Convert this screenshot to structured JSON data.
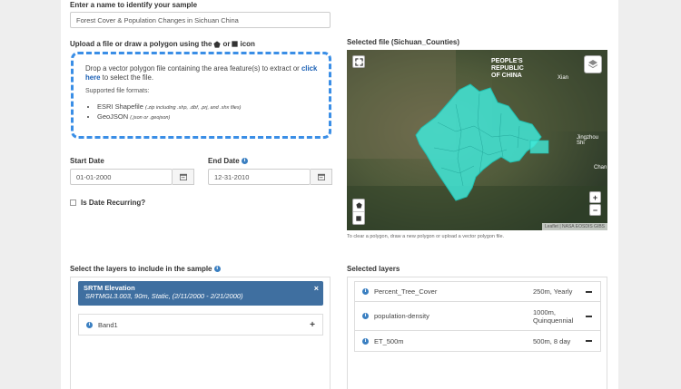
{
  "sample_name": {
    "label": "Enter a name to identify your sample",
    "value": "Forest Cover & Population Changes in Sichuan China"
  },
  "upload": {
    "label_prefix": "Upload a file or draw a polygon using the",
    "label_or": "or",
    "label_suffix": "icon",
    "drop_text": "Drop a vector polygon file containing the area feature(s) to extract or",
    "click_link": "click here",
    "drop_text_end": "to select the file.",
    "formats_label": "Supported file formats:",
    "formats": [
      {
        "name": "ESRI Shapefile",
        "detail": "(.zip including .shp, .dbf, .prj, and .shx files)"
      },
      {
        "name": "GeoJSON",
        "detail": "(.json or .geojson)"
      }
    ]
  },
  "dates": {
    "start_label": "Start Date",
    "start_value": "01-01-2000",
    "end_label": "End Date",
    "end_value": "12-31-2010",
    "recurring_label": "Is Date Recurring?"
  },
  "map": {
    "title": "Selected file (Sichuan_Counties)",
    "country_label_1": "PEOPLE'S",
    "country_label_2": "REPUBLIC",
    "country_label_3": "OF CHINA",
    "place_1": "Xian",
    "place_2": "Jingzhou Shi",
    "place_3": "Chan",
    "attribution": "Leaflet | NASA EOSDIS GIBS",
    "zoom_in": "+",
    "zoom_out": "−",
    "hint": "To clear a polygon, draw a new polygon or upload a vector polygon file.",
    "fill_color": "#41e8d8"
  },
  "layers_picker": {
    "label": "Select the layers to include in the sample",
    "selected_item": {
      "title": "SRTM Elevation",
      "subtitle": "SRTMGL3.003, 90m, Static, (2/11/2000 - 2/21/2000)",
      "close": "×"
    },
    "band": "Band1",
    "add": "+"
  },
  "selected_layers": {
    "label": "Selected layers",
    "rows": [
      {
        "name": "Percent_Tree_Cover",
        "info_line1": "250m, Yearly",
        "info_line2": ""
      },
      {
        "name": "population-density",
        "info_line1": "1000m,",
        "info_line2": "Quinquennial"
      },
      {
        "name": "ET_500m",
        "info_line1": "500m, 8 day",
        "info_line2": ""
      }
    ]
  },
  "colors": {
    "accent": "#3a8ee6",
    "selected_bg": "#3f6fa0"
  }
}
